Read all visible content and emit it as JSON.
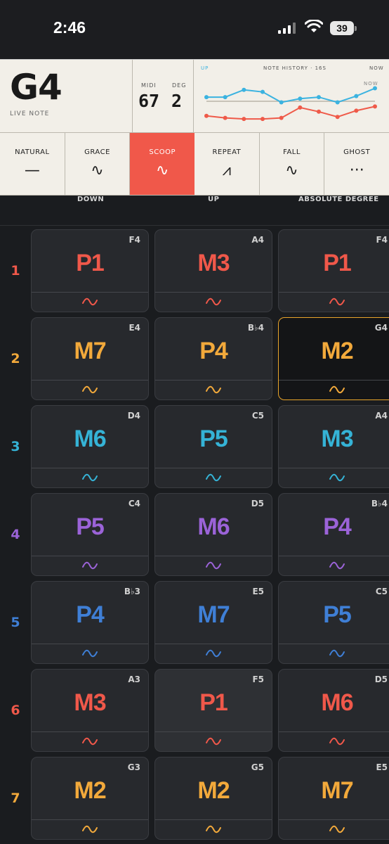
{
  "status": {
    "time": "2:46",
    "battery": "39"
  },
  "live_note": {
    "name": "G4",
    "label": "LIVE NOTE"
  },
  "midi": {
    "midi_label": "MIDI",
    "midi_value": "67",
    "deg_label": "DEG",
    "deg_value": "2"
  },
  "history": {
    "up_label": "UP",
    "title": "NOTE HISTORY · 16S",
    "now_label": "NOW",
    "now_tag": "NOW",
    "colors": {
      "up": "#3bb3e0",
      "down": "#ef5a49",
      "baseline": "#c8c3b8"
    },
    "chart_data": {
      "type": "line",
      "series": [
        {
          "values": [
            0.42,
            0.42,
            0.28,
            0.32,
            0.52,
            0.45,
            0.42,
            0.52,
            0.4,
            0.25
          ]
        },
        {
          "values": [
            0.78,
            0.82,
            0.84,
            0.84,
            0.82,
            0.62,
            0.7,
            0.8,
            0.68,
            0.6
          ]
        }
      ]
    }
  },
  "techniques": [
    {
      "label": "NATURAL",
      "icon": "dash-icon",
      "glyph": "—",
      "active": false
    },
    {
      "label": "GRACE",
      "icon": "wave-icon",
      "glyph": "∿",
      "active": false
    },
    {
      "label": "SCOOP",
      "icon": "wave-icon",
      "glyph": "∿",
      "active": true
    },
    {
      "label": "REPEAT",
      "icon": "zigzag-icon",
      "glyph": "⩘",
      "active": false
    },
    {
      "label": "FALL",
      "icon": "wave-icon",
      "glyph": "∿",
      "active": false
    },
    {
      "label": "GHOST",
      "icon": "dots-icon",
      "glyph": "···",
      "active": false
    }
  ],
  "columns": [
    "DOWN",
    "UP",
    "ABSOLUTE DEGREE"
  ],
  "row_colors": [
    "#f0584a",
    "#f2a93b",
    "#35b3d6",
    "#9b63d8",
    "#3f7fd6",
    "#f0584a",
    "#f2a93b"
  ],
  "rows": [
    {
      "num": "1",
      "cells": [
        {
          "interval": "P1",
          "note": "F4"
        },
        {
          "interval": "M3",
          "note": "A4"
        },
        {
          "interval": "P1",
          "note": "F4"
        }
      ]
    },
    {
      "num": "2",
      "cells": [
        {
          "interval": "M7",
          "note": "E4"
        },
        {
          "interval": "P4",
          "note": "B♭4"
        },
        {
          "interval": "M2",
          "note": "G4",
          "selected": true
        }
      ]
    },
    {
      "num": "3",
      "cells": [
        {
          "interval": "M6",
          "note": "D4"
        },
        {
          "interval": "P5",
          "note": "C5"
        },
        {
          "interval": "M3",
          "note": "A4"
        }
      ]
    },
    {
      "num": "4",
      "cells": [
        {
          "interval": "P5",
          "note": "C4"
        },
        {
          "interval": "M6",
          "note": "D5"
        },
        {
          "interval": "P4",
          "note": "B♭4"
        }
      ]
    },
    {
      "num": "5",
      "cells": [
        {
          "interval": "P4",
          "note": "B♭3"
        },
        {
          "interval": "M7",
          "note": "E5"
        },
        {
          "interval": "P5",
          "note": "C5"
        }
      ]
    },
    {
      "num": "6",
      "cells": [
        {
          "interval": "M3",
          "note": "A3"
        },
        {
          "interval": "P1",
          "note": "F5",
          "hover": true
        },
        {
          "interval": "M6",
          "note": "D5"
        }
      ]
    },
    {
      "num": "7",
      "cells": [
        {
          "interval": "M2",
          "note": "G3"
        },
        {
          "interval": "M2",
          "note": "G5"
        },
        {
          "interval": "M7",
          "note": "E5"
        }
      ]
    }
  ]
}
